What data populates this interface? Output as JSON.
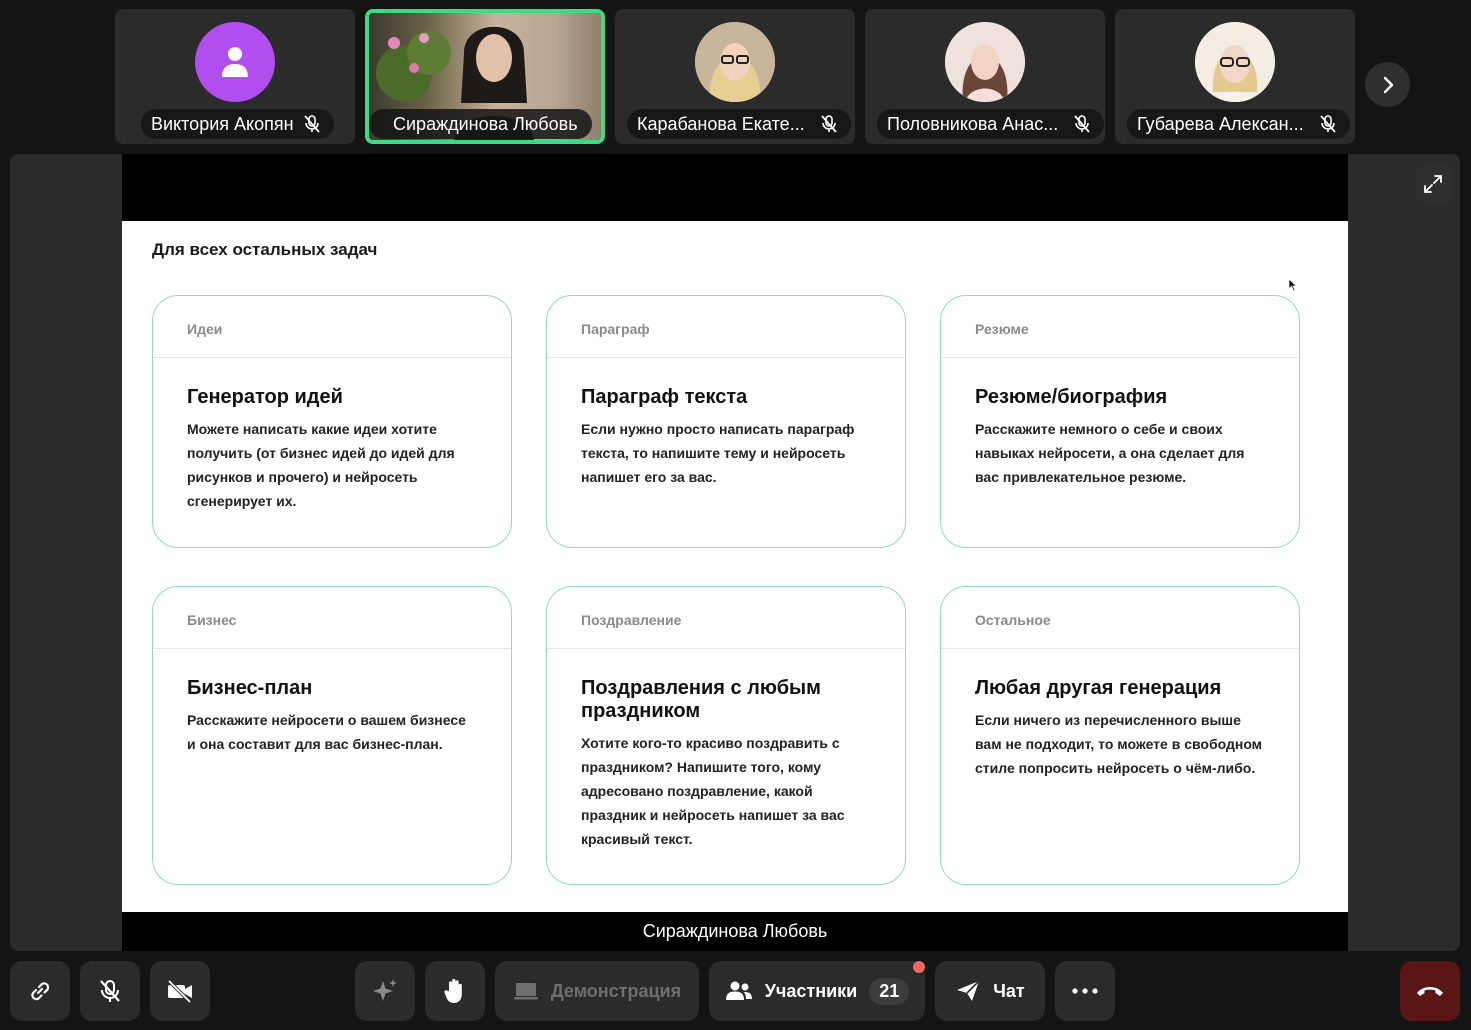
{
  "participants": [
    {
      "name": "Виктория Акопян",
      "muted": true
    },
    {
      "name": "Сираждинова Любовь",
      "muted": false,
      "active": true
    },
    {
      "name": "Карабанова Екате...",
      "muted": true
    },
    {
      "name": "Половникова Анас...",
      "muted": true
    },
    {
      "name": "Губарева Алексан...",
      "muted": true
    }
  ],
  "slide": {
    "title": "Для всех остальных задач",
    "cards": [
      {
        "category": "Идеи",
        "title": "Генератор идей",
        "description": "Можете написать какие идеи хотите получить (от бизнес идей до идей для рисунков и прочего) и нейросеть сгенерирует их."
      },
      {
        "category": "Параграф",
        "title": "Параграф текста",
        "description": "Если нужно просто написать параграф текста, то напишите тему и нейросеть напишет его за вас."
      },
      {
        "category": "Резюме",
        "title": "Резюме/биография",
        "description": "Расскажите немного о себе и своих навыках нейросети, а она сделает для вас привлекательное резюме."
      },
      {
        "category": "Бизнес",
        "title": "Бизнес-план",
        "description": "Расскажите нейросети о вашем бизнесе и она составит для вас бизнес-план."
      },
      {
        "category": "Поздравление",
        "title": "Поздравления с любым праздником",
        "description": "Хотите кого-то красиво поздравить с праздником? Напишите того, кому адресовано поздравление, какой праздник и нейросеть напишет за вас красивый текст."
      },
      {
        "category": "Остальное",
        "title": "Любая другая генерация",
        "description": "Если ничего из перечисленного выше вам не подходит, то можете в свободном стиле попросить нейросеть о чём-либо."
      }
    ]
  },
  "presenter_caption": "Сираждинова Любовь",
  "toolbar": {
    "demo_label": "Демонстрация",
    "participants_label": "Участники",
    "participants_count": "21",
    "chat_label": "Чат"
  },
  "colors": {
    "active_speaker": "#3ddb84",
    "card_border": "#8fdcc3",
    "avatar_generic": "#b24ef0",
    "end_call": "#5a1515",
    "notification": "#f06560"
  }
}
